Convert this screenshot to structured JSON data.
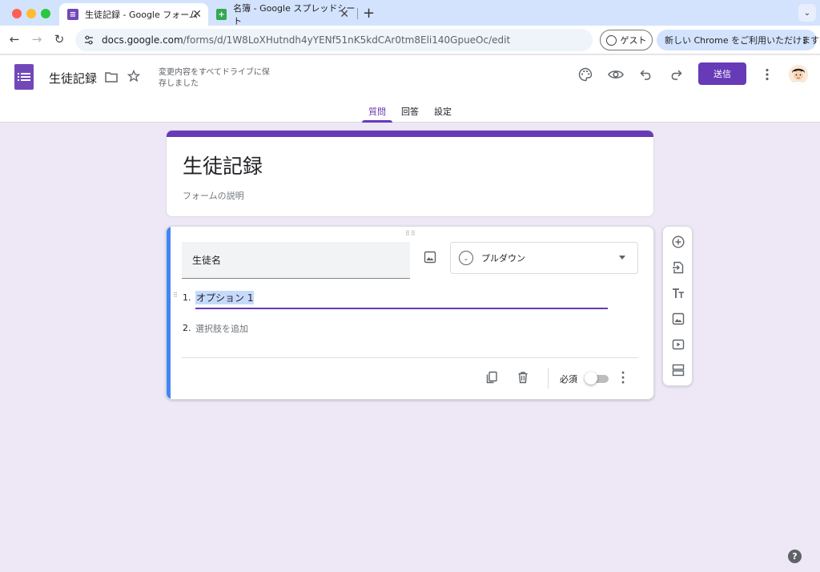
{
  "browser": {
    "tabs": [
      {
        "title": "生徒記録 - Google フォーム",
        "favicon": "forms-icon",
        "color": "#7248b9"
      },
      {
        "title": "名簿 - Google スプレッドシート",
        "favicon": "sheets-icon",
        "color": "#34a853"
      }
    ],
    "new_tab": "+",
    "url_host": "docs.google.com",
    "url_path": "/forms/d/1W8LoXHutndh4yYENf51nK5kdCAr0tm8Eli140GpueOc/edit",
    "guest_label": "ゲスト",
    "upgrade_label": "新しい Chrome をご利用いただけます",
    "upgrade_menu": "⋮"
  },
  "forms_header": {
    "doc_title": "生徒記録",
    "save_status": "変更内容をすべてドライブに保存しました",
    "send_label": "送信",
    "nav_tabs": [
      "質問",
      "回答",
      "設定"
    ],
    "active_tab": "質問",
    "accent": "#673ab7"
  },
  "title_card": {
    "title": "生徒記録",
    "description": "フォームの説明"
  },
  "question_card": {
    "question_title": "生徒名",
    "type_label": "プルダウン",
    "options": [
      {
        "num": "1.",
        "label": "オプション 1"
      },
      {
        "num": "2.",
        "label": "選択肢を追加"
      }
    ],
    "required_label": "必須",
    "required": false
  },
  "help": "?"
}
